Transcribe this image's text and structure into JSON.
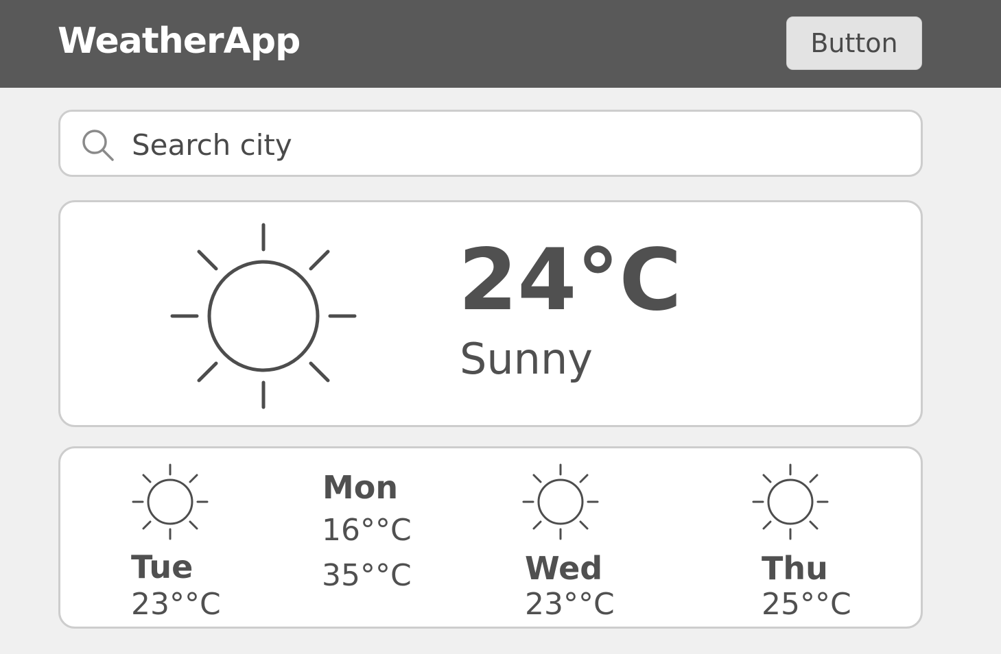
{
  "header": {
    "title": "WeatherApp",
    "button_label": "Button"
  },
  "search": {
    "placeholder": "Search city",
    "icon": "search-icon"
  },
  "current": {
    "icon": "sun-icon",
    "temperature": "24°C",
    "condition": "Sunny"
  },
  "forecast": [
    {
      "day": "Tue",
      "temp": "23°°C",
      "icon": "sun-icon"
    },
    {
      "day": "Mon",
      "temp_low": "16°°C",
      "temp_high": "35°°C"
    },
    {
      "day": "Wed",
      "temp": "23°°C",
      "icon": "sun-icon"
    },
    {
      "day": "Thu",
      "temp": "25°°C",
      "icon": "sun-icon"
    }
  ],
  "colors": {
    "header_bg": "#595959",
    "page_bg": "#f0f0f0",
    "card_bg": "#ffffff",
    "card_border": "#cdcdcd",
    "text": "#4a4a4a"
  }
}
